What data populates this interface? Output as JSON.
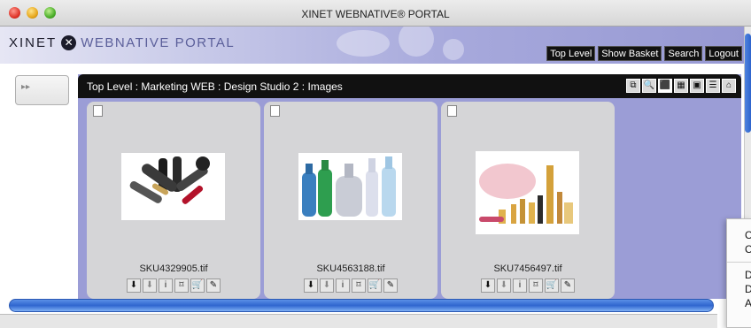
{
  "window": {
    "title": "XINET WEBNATIVE® PORTAL"
  },
  "banner": {
    "logo_main": "XINET",
    "logo_mark": "✕",
    "logo_sub": "WEBNATIVE PORTAL",
    "nav": [
      "Top Level",
      "Show Basket",
      "Search",
      "Logout"
    ]
  },
  "sidebar": {
    "toggle": "▸▸"
  },
  "browser": {
    "breadcrumb": "Top Level : Marketing WEB : Design Studio 2 : Images",
    "tools": [
      "⧉",
      "🔍",
      "⬛",
      "▦",
      "▣",
      "☰",
      "⌂"
    ]
  },
  "files": [
    {
      "name": "SKU4329905.tif",
      "thumb": "hair-tools"
    },
    {
      "name": "SKU4563188.tif",
      "thumb": "bottles"
    },
    {
      "name": "SKU7456497.tif",
      "thumb": "cosmetics"
    }
  ],
  "actions": [
    "⬇",
    "⬇",
    "i",
    "⌑",
    "🛒",
    "✎"
  ],
  "context_menu": {
    "items": [
      "C",
      "C",
      "D",
      "D",
      "A"
    ]
  },
  "colors": {
    "panel": "#9b9dd6",
    "scrollbar": "#2f66cf",
    "card": "#d5d5d7"
  }
}
